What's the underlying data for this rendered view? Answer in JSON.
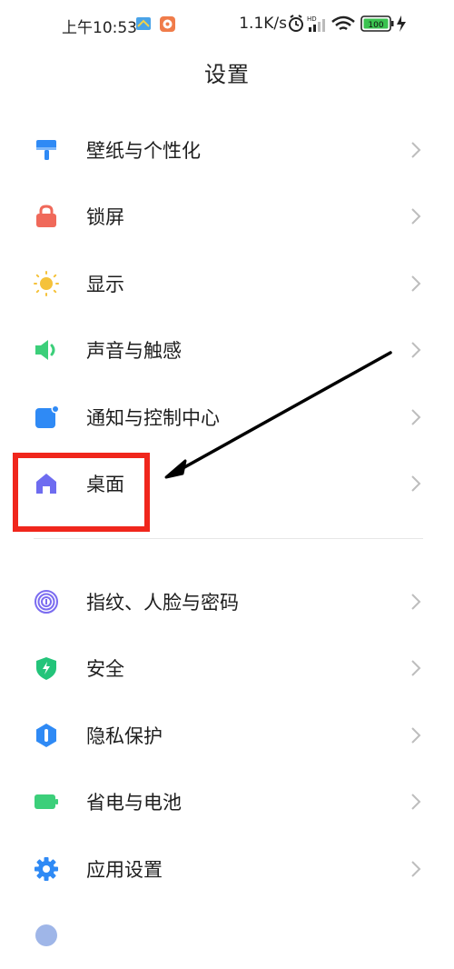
{
  "status_bar": {
    "time": "上午10:53",
    "net_speed": "1.1K/s",
    "battery": "100"
  },
  "header": {
    "title": "设置"
  },
  "settings_group_1": [
    {
      "label": "壁纸与个性化",
      "icon": "paint-roller-icon",
      "color": "#2f8af5"
    },
    {
      "label": "锁屏",
      "icon": "lock-icon",
      "color": "#f0695a"
    },
    {
      "label": "显示",
      "icon": "sun-icon",
      "color": "#f5c23a"
    },
    {
      "label": "声音与触感",
      "icon": "speaker-icon",
      "color": "#3ccf7a"
    },
    {
      "label": "通知与控制中心",
      "icon": "notification-icon",
      "color": "#2f8af5"
    },
    {
      "label": "桌面",
      "icon": "home-icon",
      "color": "#6e6cf0"
    }
  ],
  "settings_group_2": [
    {
      "label": "指纹、人脸与密码",
      "icon": "fingerprint-icon",
      "color": "#7b6cf0"
    },
    {
      "label": "安全",
      "icon": "shield-icon",
      "color": "#23c47a"
    },
    {
      "label": "隐私保护",
      "icon": "privacy-icon",
      "color": "#2f8af5"
    },
    {
      "label": "省电与电池",
      "icon": "battery-icon",
      "color": "#3ccf7a"
    },
    {
      "label": "应用设置",
      "icon": "gear-icon",
      "color": "#2f8af5"
    }
  ],
  "annotation": {
    "highlight_color": "#f0261c",
    "arrow_color": "#000000"
  }
}
